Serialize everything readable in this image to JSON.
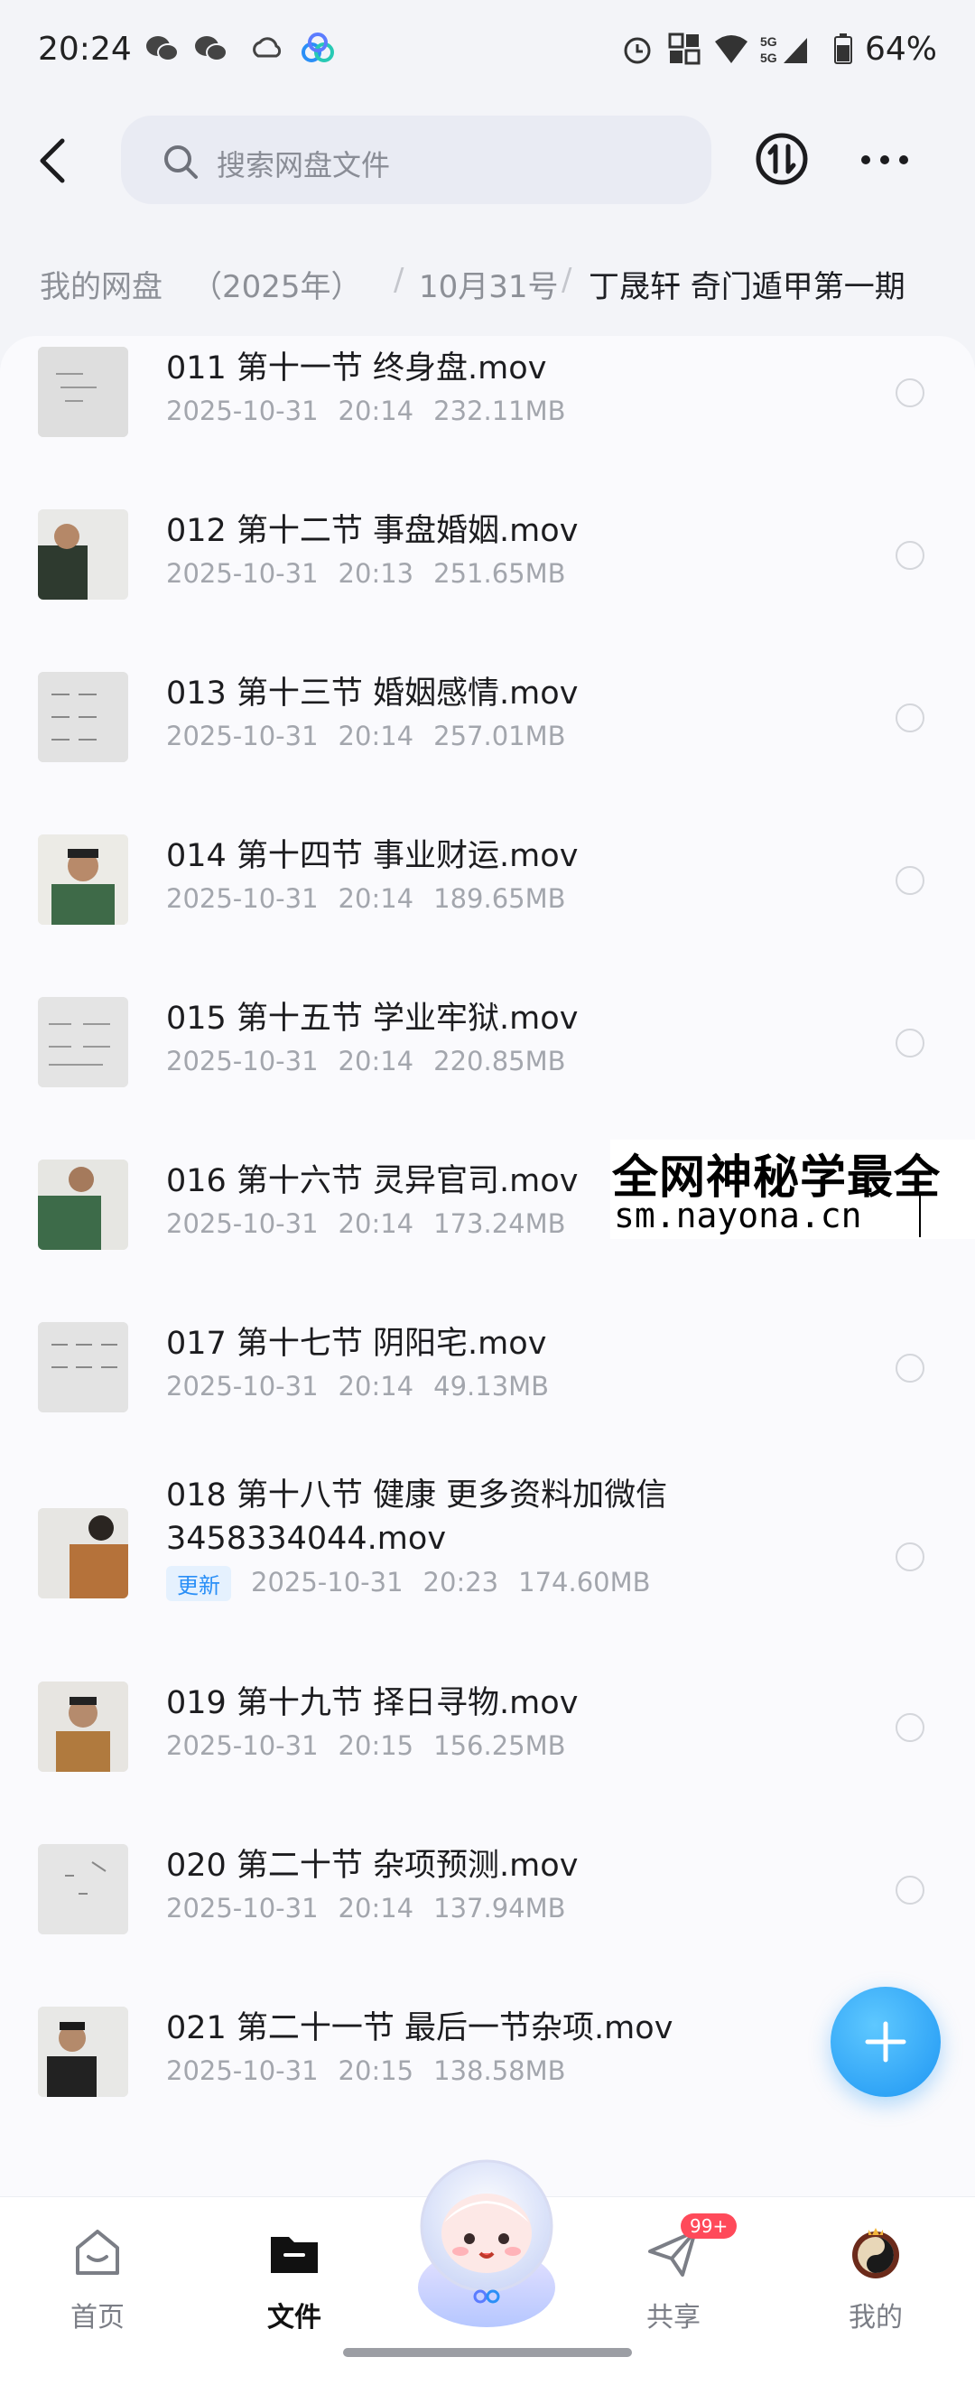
{
  "status_bar": {
    "time": "20:24",
    "battery": "64%",
    "network": "5G"
  },
  "header": {
    "search_placeholder": "搜索网盘文件"
  },
  "breadcrumb": {
    "root": "我的网盘",
    "year": "（2025年）",
    "date": "10月31号",
    "current": "丁晟轩 奇门遁甲第一期",
    "separator": "/"
  },
  "files": [
    {
      "name": "011 第十一节 终身盘.mov",
      "date": "2025-10-31",
      "time": "20:14",
      "size": "232.11MB",
      "badge": ""
    },
    {
      "name": "012 第十二节 事盘婚姻.mov",
      "date": "2025-10-31",
      "time": "20:13",
      "size": "251.65MB",
      "badge": ""
    },
    {
      "name": "013 第十三节 婚姻感情.mov",
      "date": "2025-10-31",
      "time": "20:14",
      "size": "257.01MB",
      "badge": ""
    },
    {
      "name": "014 第十四节 事业财运.mov",
      "date": "2025-10-31",
      "time": "20:14",
      "size": "189.65MB",
      "badge": ""
    },
    {
      "name": "015 第十五节 学业牢狱.mov",
      "date": "2025-10-31",
      "time": "20:14",
      "size": "220.85MB",
      "badge": ""
    },
    {
      "name": "016 第十六节 灵异官司.mov",
      "date": "2025-10-31",
      "time": "20:14",
      "size": "173.24MB",
      "badge": ""
    },
    {
      "name": "017 第十七节 阴阳宅.mov",
      "date": "2025-10-31",
      "time": "20:14",
      "size": "49.13MB",
      "badge": ""
    },
    {
      "name": "018 第十八节 健康 更多资料加微信 3458334044.mov",
      "date": "2025-10-31",
      "time": "20:23",
      "size": "174.60MB",
      "badge": "更新"
    },
    {
      "name": "019 第十九节 择日寻物.mov",
      "date": "2025-10-31",
      "time": "20:15",
      "size": "156.25MB",
      "badge": ""
    },
    {
      "name": "020 第二十节 杂项预测.mov",
      "date": "2025-10-31",
      "time": "20:14",
      "size": "137.94MB",
      "badge": ""
    },
    {
      "name": "021 第二十一节 最后一节杂项.mov",
      "date": "2025-10-31",
      "time": "20:15",
      "size": "138.58MB",
      "badge": ""
    }
  ],
  "watermark": {
    "line1": "全网神秘学最全",
    "line2": "sm.nayona.cn"
  },
  "bottom_nav": [
    {
      "label": "首页",
      "icon": "home-icon"
    },
    {
      "label": "文件",
      "icon": "folder-icon"
    },
    {
      "label": "共享",
      "icon": "paper-plane-icon",
      "badge": "99+"
    },
    {
      "label": "我的",
      "icon": "avatar-icon"
    }
  ],
  "colors": {
    "accent": "#2a8ff7",
    "fab": "#1e96f3",
    "badge_red": "#ff4a5a"
  }
}
